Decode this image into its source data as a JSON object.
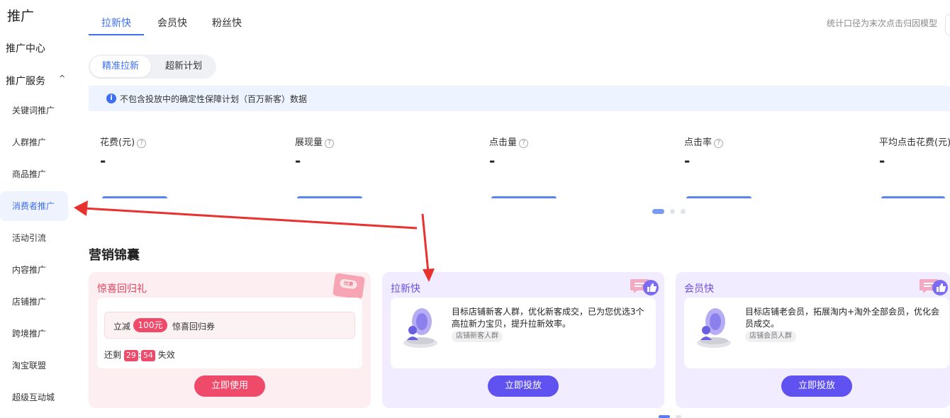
{
  "sidebar": {
    "title": "推广",
    "center": "推广中心",
    "service": "推广服务",
    "caret": "^",
    "items": [
      {
        "label": "关键词推广"
      },
      {
        "label": "人群推广"
      },
      {
        "label": "商品推广"
      },
      {
        "label": "消费者推广"
      },
      {
        "label": "活动引流"
      },
      {
        "label": "内容推广"
      },
      {
        "label": "店铺推广"
      },
      {
        "label": "跨境推广"
      },
      {
        "label": "淘宝联盟"
      },
      {
        "label": "超级互动城"
      }
    ],
    "active_item": "消费者推广"
  },
  "tabs": [
    {
      "label": "拉新快"
    },
    {
      "label": "会员快"
    },
    {
      "label": "粉丝快"
    }
  ],
  "active_tab": "拉新快",
  "stat_note": "统计口径为末次点击归因模型",
  "segment": [
    {
      "label": "精准拉新"
    },
    {
      "label": "超新计划"
    }
  ],
  "active_segment": "精准拉新",
  "info": {
    "icon": "i",
    "text": "不包含投放中的确定性保障计划（百万新客）数据"
  },
  "metrics": [
    {
      "label": "花费(元)",
      "value": "-"
    },
    {
      "label": "展现量",
      "value": "-"
    },
    {
      "label": "点击量",
      "value": "-"
    },
    {
      "label": "点击率",
      "value": "-"
    },
    {
      "label": "平均点击花费(元)",
      "value": "-"
    }
  ],
  "help_icon": "?",
  "section_title": "营销锦囊",
  "cards": {
    "gift": {
      "title": "惊喜回归礼",
      "ticket_text": "优惠",
      "coupon_pre": "立减",
      "coupon_amount": "100元",
      "coupon_post": "惊喜回归券",
      "remain_pre": "还剩",
      "minutes": "29",
      "sep": ":",
      "seconds": "54",
      "remain_post": "失效",
      "button": "立即使用"
    },
    "laxin": {
      "title": "拉新快",
      "desc": "目标店铺新客人群，优化新客成交，已为您优选3个高拉新力宝贝，提升拉新效率。",
      "tag": "店铺新客人群",
      "button": "立即投放"
    },
    "member": {
      "title": "会员快",
      "desc": "目标店铺老会员，拓展淘内+淘外全部会员，优化会员成交。",
      "tag": "店铺会员人群",
      "button": "立即投放"
    }
  },
  "colors": {
    "accent": "#3d6ff0",
    "annotation_arrow": "#e8322e",
    "gift_pink": "#f04a6a",
    "purple": "#5f52f0"
  }
}
